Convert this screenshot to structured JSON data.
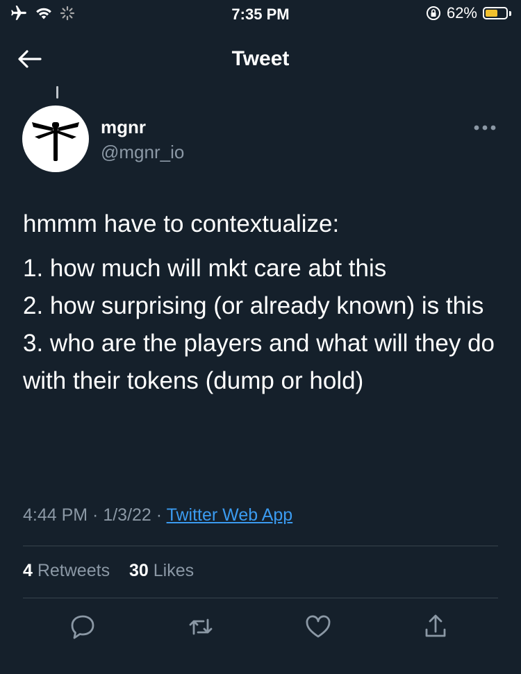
{
  "status": {
    "time": "7:35 PM",
    "battery_pct": "62%",
    "battery_level": 0.62,
    "battery_color": "#f2c12e"
  },
  "nav": {
    "title": "Tweet"
  },
  "author": {
    "name": "mgnr",
    "handle": "@mgnr_io"
  },
  "tweet": {
    "lines": [
      "hmmm have to contextualize:",
      "1. how much will mkt care abt this",
      "2. how surprising (or already known) is this",
      "3. who are the players and what will they do with their tokens (dump or hold)"
    ]
  },
  "meta": {
    "time": "4:44 PM",
    "sep1": " · ",
    "date": "1/3/22",
    "sep2": " · ",
    "source": "Twitter Web App"
  },
  "stats": {
    "retweets_count": "4",
    "retweets_label": " Retweets",
    "likes_count": "30",
    "likes_label": " Likes"
  },
  "icons": [
    "airplane-icon",
    "wifi-icon",
    "loading-icon",
    "orientation-lock-icon",
    "battery-icon",
    "back-arrow-icon",
    "more-icon",
    "reply-icon",
    "retweet-icon",
    "like-icon",
    "share-icon"
  ],
  "colors": {
    "background": "#15202b",
    "secondary_text": "#8b98a5",
    "link": "#3b9bf0",
    "divider": "#38444d"
  }
}
